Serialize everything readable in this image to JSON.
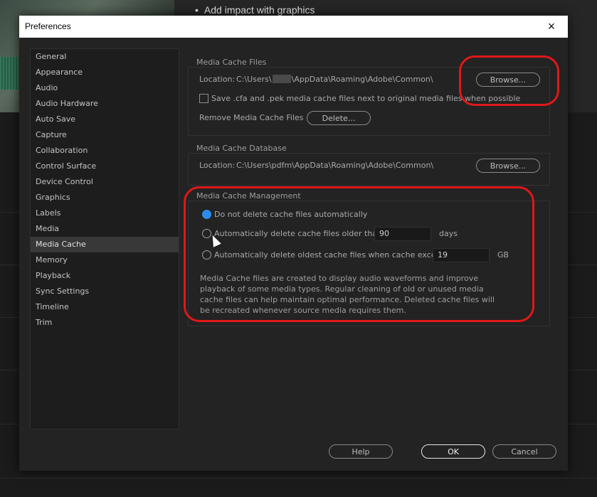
{
  "background": {
    "slide_bullet": "Add impact with graphics"
  },
  "dialog": {
    "title": "Preferences",
    "close_icon": "×"
  },
  "sidebar": {
    "items": [
      {
        "label": "General"
      },
      {
        "label": "Appearance"
      },
      {
        "label": "Audio"
      },
      {
        "label": "Audio Hardware"
      },
      {
        "label": "Auto Save"
      },
      {
        "label": "Capture"
      },
      {
        "label": "Collaboration"
      },
      {
        "label": "Control Surface"
      },
      {
        "label": "Device Control"
      },
      {
        "label": "Graphics"
      },
      {
        "label": "Labels"
      },
      {
        "label": "Media"
      },
      {
        "label": "Media Cache"
      },
      {
        "label": "Memory"
      },
      {
        "label": "Playback"
      },
      {
        "label": "Sync Settings"
      },
      {
        "label": "Timeline"
      },
      {
        "label": "Trim"
      }
    ],
    "selected": "Media Cache"
  },
  "media_cache_files": {
    "title": "Media Cache Files",
    "location_label": "Location:",
    "location_prefix": "C:\\Users\\",
    "location_suffix": "\\AppData\\Roaming\\Adobe\\Common\\",
    "browse_label": "Browse...",
    "save_checkbox_label": "Save .cfa and .pek media cache files next to original media files when possible",
    "save_checked": false,
    "remove_label": "Remove Media Cache Files",
    "delete_label": "Delete..."
  },
  "media_cache_database": {
    "title": "Media Cache Database",
    "location_label": "Location:",
    "location_value": "C:\\Users\\pdfm\\AppData\\Roaming\\Adobe\\Common\\",
    "browse_label": "Browse..."
  },
  "media_cache_management": {
    "title": "Media Cache Management",
    "option_no_delete": "Do not delete cache files automatically",
    "option_older_than": "Automatically delete cache files older than:",
    "older_than_value": "90",
    "older_than_unit": "days",
    "option_exceeds": "Automatically delete oldest cache files when cache exceeds:",
    "exceeds_value": "19",
    "exceeds_unit": "GB",
    "selected_option": "Do not delete cache files automatically",
    "description": "Media Cache files are created to display audio waveforms and improve playback of some media types.  Regular cleaning of old or unused media cache files can help maintain optimal performance. Deleted cache files will be recreated whenever source media requires them."
  },
  "footer": {
    "help_label": "Help",
    "ok_label": "OK",
    "cancel_label": "Cancel"
  },
  "colors": {
    "radio_selected": "#2d8ceb",
    "annotation_ring": "#e01818"
  }
}
